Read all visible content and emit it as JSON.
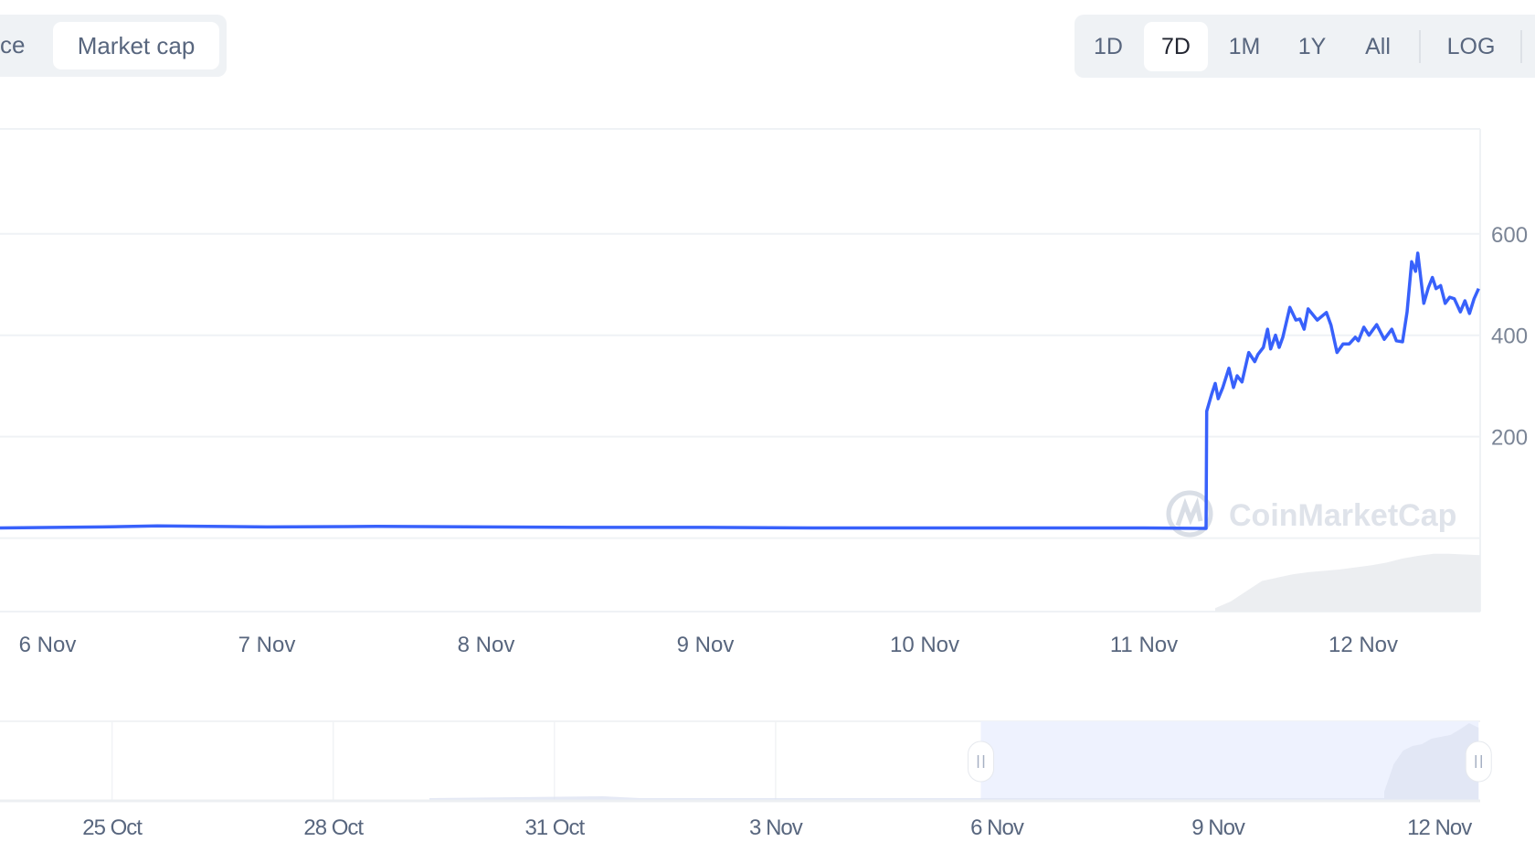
{
  "tabs": {
    "items": [
      {
        "label": "ce"
      },
      {
        "label": "Market cap",
        "active": true
      }
    ]
  },
  "range": {
    "items": [
      {
        "label": "1D"
      },
      {
        "label": "7D",
        "active": true
      },
      {
        "label": "1M"
      },
      {
        "label": "1Y"
      },
      {
        "label": "All"
      },
      {
        "label": "LOG"
      }
    ]
  },
  "watermark": "CoinMarketCap",
  "colors": {
    "line": "#3861fb",
    "grid": "#eff2f5",
    "selection": "#eef2fe",
    "volume": "#e6e8ec"
  },
  "chart_data": {
    "type": "line",
    "title": "",
    "xlabel": "",
    "ylabel": "",
    "grid": true,
    "ylim": [
      -145,
      807
    ],
    "yticks": [
      "200",
      "400",
      "600"
    ],
    "yticks_values": [
      200,
      400,
      600
    ],
    "xticks": [
      "6 Nov",
      "7 Nov",
      "8 Nov",
      "9 Nov",
      "10 Nov",
      "11 Nov",
      "12 Nov"
    ],
    "xlim": [
      "5 Nov 18:48",
      "12 Nov 12:48"
    ],
    "series": [
      {
        "x": [
          "5 Nov 18:48",
          "6 Nov 06:00",
          "6 Nov 12:00",
          "7 Nov 00:00",
          "7 Nov 12:00",
          "8 Nov 00:00",
          "8 Nov 12:00",
          "9 Nov 00:00",
          "9 Nov 12:00",
          "10 Nov 00:00",
          "10 Nov 12:00",
          "11 Nov 00:00",
          "11 Nov 06:48",
          "11 Nov 06:52",
          "11 Nov 07:24",
          "11 Nov 07:48",
          "11 Nov 08:08",
          "11 Nov 08:38",
          "11 Nov 09:18",
          "11 Nov 09:48",
          "11 Nov 10:12",
          "11 Nov 10:44",
          "11 Nov 11:28",
          "11 Nov 12:08",
          "11 Nov 12:28",
          "11 Nov 13:04",
          "11 Nov 13:32",
          "11 Nov 13:52",
          "11 Nov 14:24",
          "11 Nov 14:48",
          "11 Nov 15:12",
          "11 Nov 15:58",
          "11 Nov 16:38",
          "11 Nov 17:04",
          "11 Nov 17:32",
          "11 Nov 17:58",
          "11 Nov 18:58",
          "11 Nov 19:58",
          "11 Nov 20:28",
          "11 Nov 21:08",
          "11 Nov 21:48",
          "11 Nov 22:28",
          "11 Nov 23:08",
          "11 Nov 23:28",
          "12 Nov 00:04",
          "12 Nov 00:38",
          "12 Nov 01:28",
          "12 Nov 02:18",
          "12 Nov 03:08",
          "12 Nov 03:38",
          "12 Nov 04:18",
          "12 Nov 04:48",
          "12 Nov 05:18",
          "12 Nov 05:44",
          "12 Nov 05:58",
          "12 Nov 06:38",
          "12 Nov 07:08",
          "12 Nov 07:34",
          "12 Nov 07:58",
          "12 Nov 08:28",
          "12 Nov 08:58",
          "12 Nov 09:28",
          "12 Nov 09:58",
          "12 Nov 10:38",
          "12 Nov 11:08",
          "12 Nov 11:38",
          "12 Nov 12:08",
          "12 Nov 12:38"
        ],
        "y": [
          20,
          22,
          24,
          22,
          23,
          22,
          21,
          21,
          20,
          20,
          20,
          20,
          19,
          250,
          283,
          305,
          275,
          297,
          335,
          297,
          320,
          308,
          366,
          348,
          362,
          376,
          412,
          373,
          400,
          376,
          396,
          455,
          430,
          432,
          412,
          452,
          430,
          445,
          420,
          366,
          383,
          383,
          396,
          389,
          416,
          400,
          421,
          392,
          412,
          389,
          387,
          446,
          545,
          526,
          562,
          463,
          494,
          514,
          492,
          498,
          463,
          475,
          472,
          446,
          468,
          443,
          472,
          492
        ]
      }
    ],
    "volume_relative": [
      0.05,
      0.15,
      0.3,
      0.45,
      0.5,
      0.55,
      0.58,
      0.6,
      0.62,
      0.65,
      0.68,
      0.72,
      0.78,
      0.82,
      0.85,
      0.85,
      0.84,
      0.83
    ],
    "navigator": {
      "xticks": [
        "25 Oct",
        "28 Oct",
        "31 Oct",
        "3 Nov",
        "6 Nov",
        "9 Nov",
        "12 Nov"
      ],
      "selection": [
        "5 Nov 18:48",
        "12 Nov 12:48"
      ]
    }
  }
}
